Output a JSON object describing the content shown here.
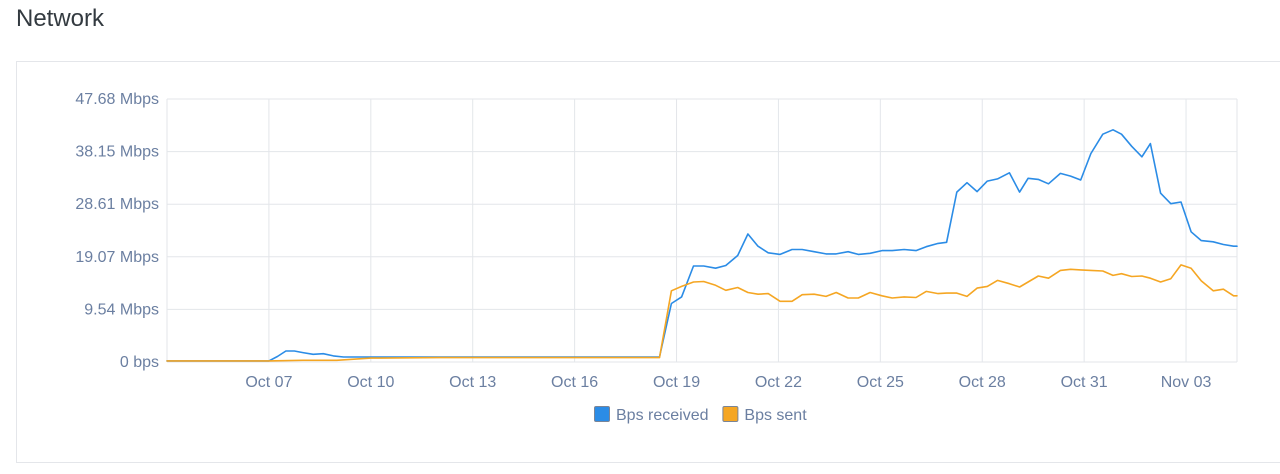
{
  "page": {
    "title": "Network"
  },
  "chart_data": {
    "type": "line",
    "title": "",
    "xlabel": "",
    "ylabel": "",
    "y_ticks": [
      "0 bps",
      "9.54 Mbps",
      "19.07 Mbps",
      "28.61 Mbps",
      "38.15 Mbps",
      "47.68 Mbps"
    ],
    "y_tick_values": [
      0,
      9.54,
      19.07,
      28.61,
      38.15,
      47.68
    ],
    "ylim": [
      0,
      47.68
    ],
    "x_ticks": [
      "Oct 07",
      "Oct 10",
      "Oct 13",
      "Oct 16",
      "Oct 19",
      "Oct 22",
      "Oct 25",
      "Oct 28",
      "Oct 31",
      "Nov 03"
    ],
    "x_tick_values": [
      7,
      10,
      13,
      16,
      19,
      22,
      25,
      28,
      31,
      34
    ],
    "xlim": [
      4,
      35.5
    ],
    "grid": true,
    "legend": "bottom-center",
    "series": [
      {
        "name": "Bps received",
        "color": "#2b8ce6",
        "x": [
          4,
          5,
          6,
          7,
          7.25,
          7.5,
          7.75,
          8,
          8.3,
          8.6,
          8.9,
          9.2,
          9.5,
          10,
          12,
          14,
          16,
          17.5,
          18.5,
          18.85,
          19.15,
          19.5,
          19.8,
          20.15,
          20.45,
          20.8,
          21.1,
          21.4,
          21.7,
          22.05,
          22.4,
          22.7,
          23.05,
          23.4,
          23.7,
          24.05,
          24.35,
          24.7,
          25.05,
          25.35,
          25.7,
          26.05,
          26.35,
          26.7,
          26.95,
          27.25,
          27.55,
          27.85,
          28.15,
          28.45,
          28.8,
          29.1,
          29.35,
          29.65,
          29.95,
          30.3,
          30.6,
          30.9,
          31.2,
          31.55,
          31.85,
          32.1,
          32.4,
          32.7,
          32.95,
          33.25,
          33.55,
          33.85,
          34.15,
          34.45,
          34.8,
          35.1,
          35.4,
          35.5
        ],
        "values": [
          0.2,
          0.2,
          0.2,
          0.2,
          1.0,
          2.0,
          2.0,
          1.7,
          1.4,
          1.5,
          1.1,
          0.9,
          0.9,
          0.9,
          0.9,
          0.9,
          0.9,
          0.9,
          0.9,
          10.6,
          11.8,
          17.4,
          17.4,
          17.0,
          17.5,
          19.3,
          23.2,
          21.0,
          19.8,
          19.5,
          20.4,
          20.4,
          20.0,
          19.6,
          19.6,
          20.0,
          19.5,
          19.7,
          20.2,
          20.2,
          20.4,
          20.2,
          20.9,
          21.5,
          21.7,
          30.8,
          32.5,
          30.9,
          32.8,
          33.2,
          34.3,
          30.8,
          33.3,
          33.1,
          32.3,
          34.2,
          33.7,
          33.0,
          37.8,
          41.3,
          42.1,
          41.3,
          39.1,
          37.2,
          39.6,
          30.6,
          28.7,
          29.0,
          23.6,
          22.0,
          21.8,
          21.3,
          21.0,
          21.0
        ]
      },
      {
        "name": "Bps sent",
        "color": "#f5a623",
        "x": [
          4,
          7,
          8,
          9,
          9.5,
          10,
          12,
          14,
          16,
          18.5,
          18.85,
          19.15,
          19.5,
          19.8,
          20.15,
          20.45,
          20.8,
          21.1,
          21.4,
          21.7,
          22.05,
          22.4,
          22.7,
          23.05,
          23.4,
          23.7,
          24.05,
          24.35,
          24.7,
          25.05,
          25.35,
          25.7,
          26.05,
          26.35,
          26.7,
          26.95,
          27.25,
          27.55,
          27.85,
          28.15,
          28.45,
          28.8,
          29.1,
          29.35,
          29.65,
          29.95,
          30.3,
          30.6,
          30.9,
          31.2,
          31.55,
          31.85,
          32.1,
          32.4,
          32.7,
          32.95,
          33.25,
          33.55,
          33.85,
          34.15,
          34.45,
          34.8,
          35.1,
          35.4,
          35.5
        ],
        "values": [
          0.2,
          0.2,
          0.3,
          0.3,
          0.5,
          0.7,
          0.8,
          0.8,
          0.8,
          0.8,
          12.9,
          13.7,
          14.5,
          14.6,
          13.9,
          13.0,
          13.5,
          12.6,
          12.3,
          12.4,
          11.0,
          11.0,
          12.2,
          12.3,
          11.9,
          12.6,
          11.6,
          11.6,
          12.6,
          12.0,
          11.6,
          11.8,
          11.7,
          12.8,
          12.4,
          12.5,
          12.5,
          11.9,
          13.4,
          13.7,
          14.8,
          14.2,
          13.6,
          14.5,
          15.6,
          15.2,
          16.6,
          16.8,
          16.7,
          16.6,
          16.5,
          15.7,
          16.0,
          15.5,
          15.6,
          15.2,
          14.5,
          15.1,
          17.6,
          17.0,
          14.7,
          12.9,
          13.2,
          12.0,
          12.0
        ]
      }
    ]
  }
}
